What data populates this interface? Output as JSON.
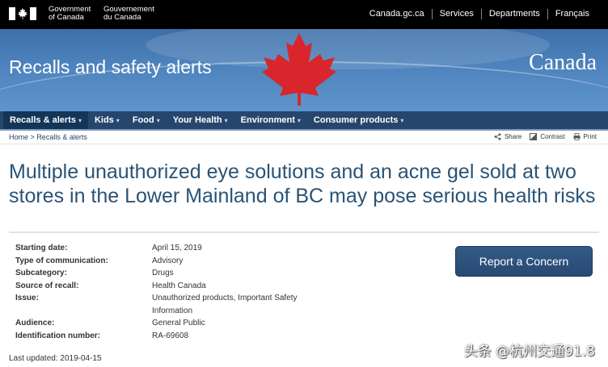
{
  "header": {
    "government_en": "Government\nof Canada",
    "government_fr": "Gouvernement\ndu Canada",
    "links": [
      "Canada.gc.ca",
      "Services",
      "Departments",
      "Français"
    ]
  },
  "banner": {
    "title": "Recalls and safety alerts",
    "wordmark": "Canada"
  },
  "nav": {
    "items": [
      {
        "label": "Recalls & alerts",
        "active": true
      },
      {
        "label": "Kids"
      },
      {
        "label": "Food"
      },
      {
        "label": "Your Health"
      },
      {
        "label": "Environment"
      },
      {
        "label": "Consumer products"
      }
    ]
  },
  "breadcrumb": {
    "home": "Home",
    "separator": ">",
    "current": "Recalls & alerts"
  },
  "tools": {
    "share": "Share",
    "contrast": "Contrast",
    "print": "Print"
  },
  "page": {
    "title": "Multiple unauthorized eye solutions and an acne gel sold at two stores in the Lower Mainland of BC may pose serious health risks"
  },
  "details": [
    {
      "label": "Starting date:",
      "value": "April 15, 2019"
    },
    {
      "label": "Type of communication:",
      "value": "Advisory"
    },
    {
      "label": "Subcategory:",
      "value": "Drugs"
    },
    {
      "label": "Source of recall:",
      "value": "Health Canada"
    },
    {
      "label": "Issue:",
      "value": "Unauthorized products, Important Safety Information"
    },
    {
      "label": "Audience:",
      "value": "General Public"
    },
    {
      "label": "Identification number:",
      "value": "RA-69608"
    }
  ],
  "report_button": "Report a Concern",
  "last_updated": "Last updated: 2019-04-15",
  "watermark": "头条 @杭州交通91.8",
  "colors": {
    "nav_bg": "#26466d",
    "banner": "#4e83bd",
    "title": "#295376",
    "leaf": "#d9262c",
    "button": "#2d5280"
  }
}
